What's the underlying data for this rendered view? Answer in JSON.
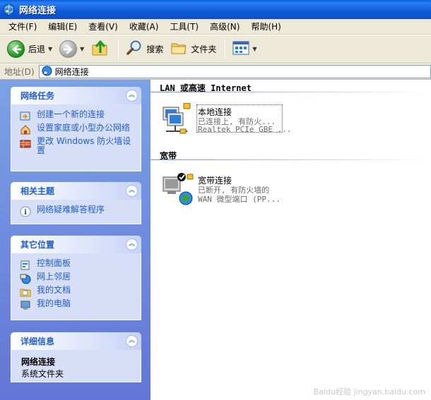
{
  "window": {
    "title": "网络连接"
  },
  "menu": [
    "文件(F)",
    "编辑(E)",
    "查看(V)",
    "收藏(A)",
    "工具(T)",
    "高级(N)",
    "帮助(H)"
  ],
  "toolbar": {
    "back": "后退",
    "search": "搜索",
    "folders": "文件夹"
  },
  "address": {
    "label": "地址(D)",
    "value": "网络连接"
  },
  "tasks": {
    "network_tasks": {
      "title": "网络任务",
      "items": [
        "创建一个新的连接",
        "设置家庭或小型办公网络",
        "更改 Windows 防火墙设置"
      ]
    },
    "related": {
      "title": "相关主题",
      "items": [
        "网络疑难解答程序"
      ]
    },
    "other_places": {
      "title": "其它位置",
      "items": [
        "控制面板",
        "网上邻居",
        "我的文档",
        "我的电脑"
      ]
    },
    "details": {
      "title": "详细信息",
      "name": "网络连接",
      "type": "系统文件夹"
    }
  },
  "groups": {
    "lan": {
      "title": "LAN 或高速 Internet",
      "conn": {
        "name": "本地连接",
        "status": "已连接上, 有防火...",
        "device": "Realtek PCIe GBE ..."
      }
    },
    "broadband": {
      "title": "宽带",
      "conn": {
        "name": "宽带连接",
        "status": "已断开, 有防火墙的",
        "device": "WAN 微型端口 (PP..."
      }
    }
  },
  "watermark": "Baidu经验 jingyan.baidu.com"
}
